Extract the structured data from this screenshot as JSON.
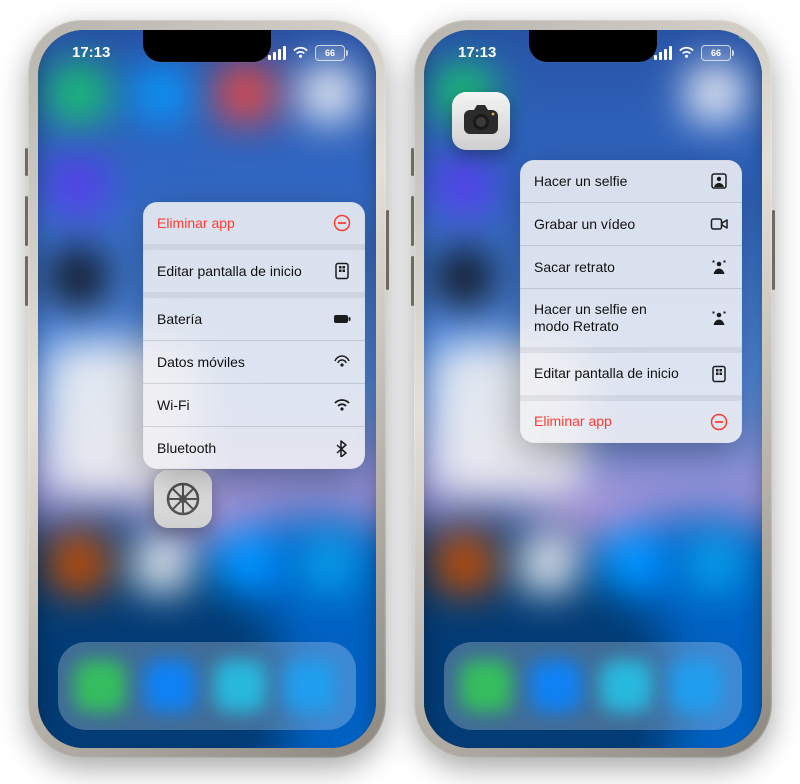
{
  "status": {
    "time": "17:13",
    "battery": "66"
  },
  "left_phone": {
    "app_icon_name": "settings-icon",
    "menu_items": [
      {
        "label": "Eliminar app",
        "icon": "delete-icon",
        "destructive": true
      },
      {
        "label": "Editar pantalla de inicio",
        "icon": "edit-home-icon",
        "sep_above": true
      },
      {
        "label": "Batería",
        "icon": "battery-icon",
        "sep_above": true
      },
      {
        "label": "Datos móviles",
        "icon": "cellular-icon"
      },
      {
        "label": "Wi-Fi",
        "icon": "wifi-icon"
      },
      {
        "label": "Bluetooth",
        "icon": "bluetooth-icon"
      }
    ]
  },
  "right_phone": {
    "app_icon_name": "camera-icon",
    "menu_items": [
      {
        "label": "Hacer un selfie",
        "icon": "selfie-icon"
      },
      {
        "label": "Grabar un vídeo",
        "icon": "video-icon"
      },
      {
        "label": "Sacar retrato",
        "icon": "portrait-icon"
      },
      {
        "label": "Hacer un selfie en\nmodo Retrato",
        "icon": "portrait-selfie-icon"
      },
      {
        "label": "Editar pantalla de inicio",
        "icon": "edit-home-icon",
        "sep_above": true
      },
      {
        "label": "Eliminar app",
        "icon": "delete-icon",
        "destructive": true,
        "sep_above": true
      }
    ]
  }
}
